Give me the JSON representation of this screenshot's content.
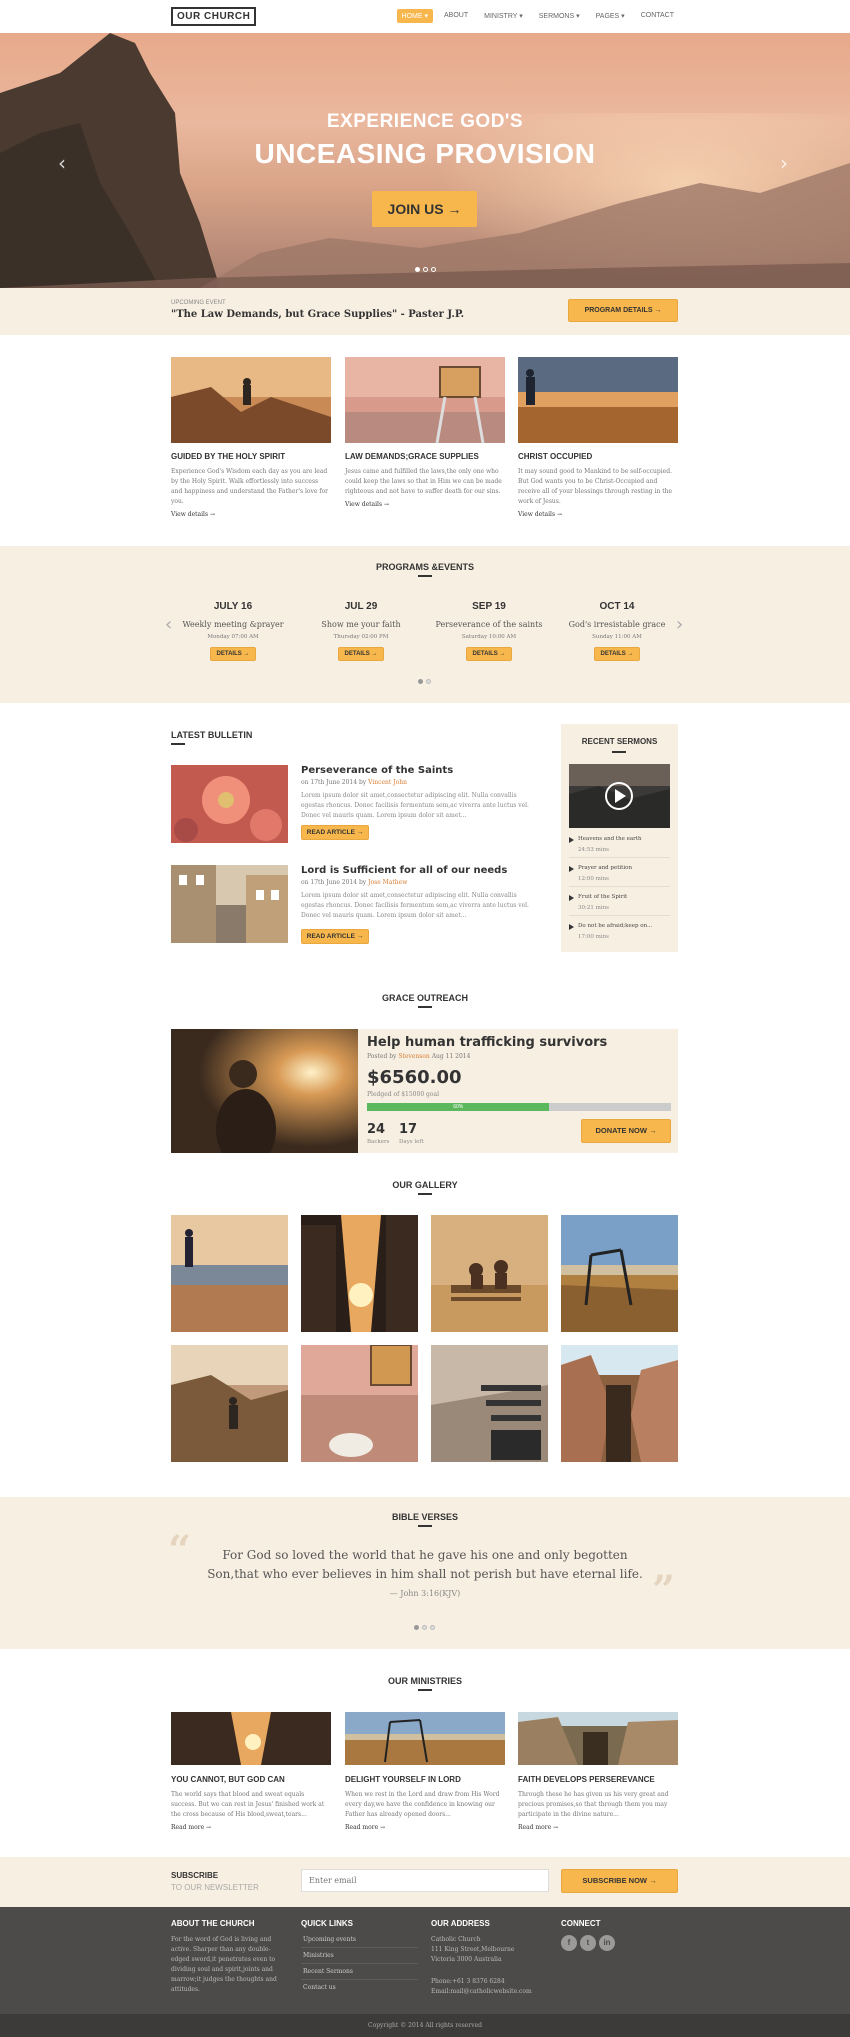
{
  "header": {
    "logo": "OUR CHURCH",
    "nav": [
      "HOME ▾",
      "ABOUT",
      "MINISTRY ▾",
      "SERMONS ▾",
      "PAGES ▾",
      "CONTACT"
    ]
  },
  "hero": {
    "line1": "EXPERIENCE GOD'S",
    "line2": "UNCEASING PROVISION",
    "button": "JOIN US →",
    "prev": "‹",
    "next": "›"
  },
  "upcoming": {
    "label": "UPCOMING EVENT",
    "title": "\"The Law Demands, but Grace Supplies\" - Paster J.P.",
    "button": "PROGRAM DETAILS →"
  },
  "features": [
    {
      "title": "GUIDED BY THE HOLY SPIRIT",
      "text": "Experience God's Wisdom each day as you are lead by the Holy Spirit. Walk effortlessly into success and happiness and understand the Father's love for you.",
      "link": "View details →"
    },
    {
      "title": "LAW DEMANDS;GRACE SUPPLIES",
      "text": "Jesus came and fulfilled the laws,the only one who could keep the laws so that in Him we can be made righteous and not have to suffer death for our sins.",
      "link": "View details →"
    },
    {
      "title": "CHRIST OCCUPIED",
      "text": "It may sound good to Mankind to be self-occupied. But God wants you to be Christ-Occupied and receive all of your blessings through resting in the work of Jesus.",
      "link": "View details →"
    }
  ],
  "programs": {
    "heading": "PROGRAMS &EVENTS",
    "events": [
      {
        "date": "JULY 16",
        "name": "Weekly meeting &prayer",
        "time": "Monday 07:00 AM",
        "button": "DETAILS →"
      },
      {
        "date": "JUL 29",
        "name": "Show me your faith",
        "time": "Thursday 02:00 PM",
        "button": "DETAILS →"
      },
      {
        "date": "SEP 19",
        "name": "Perseverance of the saints",
        "time": "Saturday 10:00 AM",
        "button": "DETAILS →"
      },
      {
        "date": "OCT 14",
        "name": "God's irresistable grace",
        "time": "Sunday 11:00 AM",
        "button": "DETAILS →"
      }
    ],
    "prev": "‹",
    "next": "›"
  },
  "bulletin": {
    "heading": "LATEST BULLETIN",
    "posts": [
      {
        "title": "Perseverance of the Saints",
        "meta_prefix": "on 17th June 2014 by ",
        "author": "Vincent John",
        "excerpt": "Lorem ipsum dolor sit amet,consectetur adipiscing elit. Nulla convallis egestas rhoncus. Donec facilisis fermentum sem,ac viverra ante luctus vel. Donec vel mauris quam. Lorem ipsum dolor sit amet...",
        "button": "READ ARTICLE →"
      },
      {
        "title": "Lord is Sufficient for all of our needs",
        "meta_prefix": "on 17th June 2014 by ",
        "author": "Jose Mathew",
        "excerpt": "Lorem ipsum dolor sit amet,consectetur adipiscing elit. Nulla convallis egestas rhoncus. Donec facilisis fermentum sem,ac viverra ante luctus vel. Donec vel mauris quam. Lorem ipsum dolor sit amet...",
        "button": "READ ARTICLE →"
      }
    ]
  },
  "sermons": {
    "heading": "RECENT SERMONS",
    "items": [
      {
        "title": "Heavens and the earth",
        "length": "24:53 mins"
      },
      {
        "title": "Prayer and petition",
        "length": "12:00 mins"
      },
      {
        "title": "Fruit of the Spirit",
        "length": "30:21 mins"
      },
      {
        "title": "Do not be afraid;keep on...",
        "length": "17:00 mins"
      }
    ]
  },
  "outreach": {
    "heading": "GRACE OUTREACH",
    "title": "Help human trafficking survivors",
    "meta_prefix": "Posted by ",
    "author": "Stevenson",
    "date": " Aug 11 2014",
    "amount": "$6560.00",
    "pledged": "Pledged of $15000 goal",
    "progress_percent": 60,
    "progress_label": "60%",
    "backers": "24",
    "backers_label": "Backers",
    "days": "17",
    "days_label": "Days left",
    "button": "DONATE NOW →"
  },
  "gallery": {
    "heading": "OUR GALLERY"
  },
  "verses": {
    "heading": "BIBLE VERSES",
    "quote": "For God so loved the world that he gave his one and only begotten Son,that who ever believes in him shall not perish but have eternal life.",
    "ref": "— John 3:16(KJV)",
    "open_quote": "“",
    "close_quote": "”"
  },
  "ministries": {
    "heading": "OUR MINISTRIES",
    "items": [
      {
        "title": "YOU CANNOT, BUT GOD CAN",
        "text": "The world says that blood and sweat equals success. But we can rest in Jesus' finished work at the cross because of His blood,sweat,tears...",
        "link": "Read more →"
      },
      {
        "title": "DELIGHT YOURSELF IN LORD",
        "text": "When we rest in the Lord and draw from His Word every day,we have the confidence in knowing our Father has already opened doors...",
        "link": "Read more →"
      },
      {
        "title": "FAITH DEVELOPS PERSEREVANCE",
        "text": "Through these he has given us his very great and precious promises,so that through them you may participate in the divine nature...",
        "link": "Read more →"
      }
    ]
  },
  "subscribe": {
    "title": "SUBSCRIBE",
    "subtitle": "TO OUR NEWSLETTER",
    "placeholder": "Enter email",
    "button": "SUBSCRIBE NOW →"
  },
  "footer": {
    "about_heading": "ABOUT THE CHURCH",
    "about_text": "For the word of God is living and active. Sharper than any double-edged sword,it penetrates even to dividing soul and spirit,joints and marrow;it judges the thoughts and attitudes.",
    "links_heading": "QUICK LINKS",
    "links": [
      "Upcoming events",
      "Ministries",
      "Recent Sermons",
      "Contact us"
    ],
    "address_heading": "OUR ADDRESS",
    "address": [
      "Catholic Church",
      "111 King Street,Melbourne",
      "Victoria 3000 Australia"
    ],
    "phone": "Phone:+61 3 8376 6284",
    "email": "Email:mail@catholicwebsite.com",
    "connect_heading": "CONNECT",
    "social": [
      "f",
      "t",
      "in"
    ],
    "copyright": "Copyright © 2014 All rights reserved"
  },
  "colors": {
    "accent": "#f7b74d",
    "cream": "#f8efe3",
    "footer": "#4c4b49",
    "link": "#d77c30",
    "progress": "#5cb85c"
  }
}
